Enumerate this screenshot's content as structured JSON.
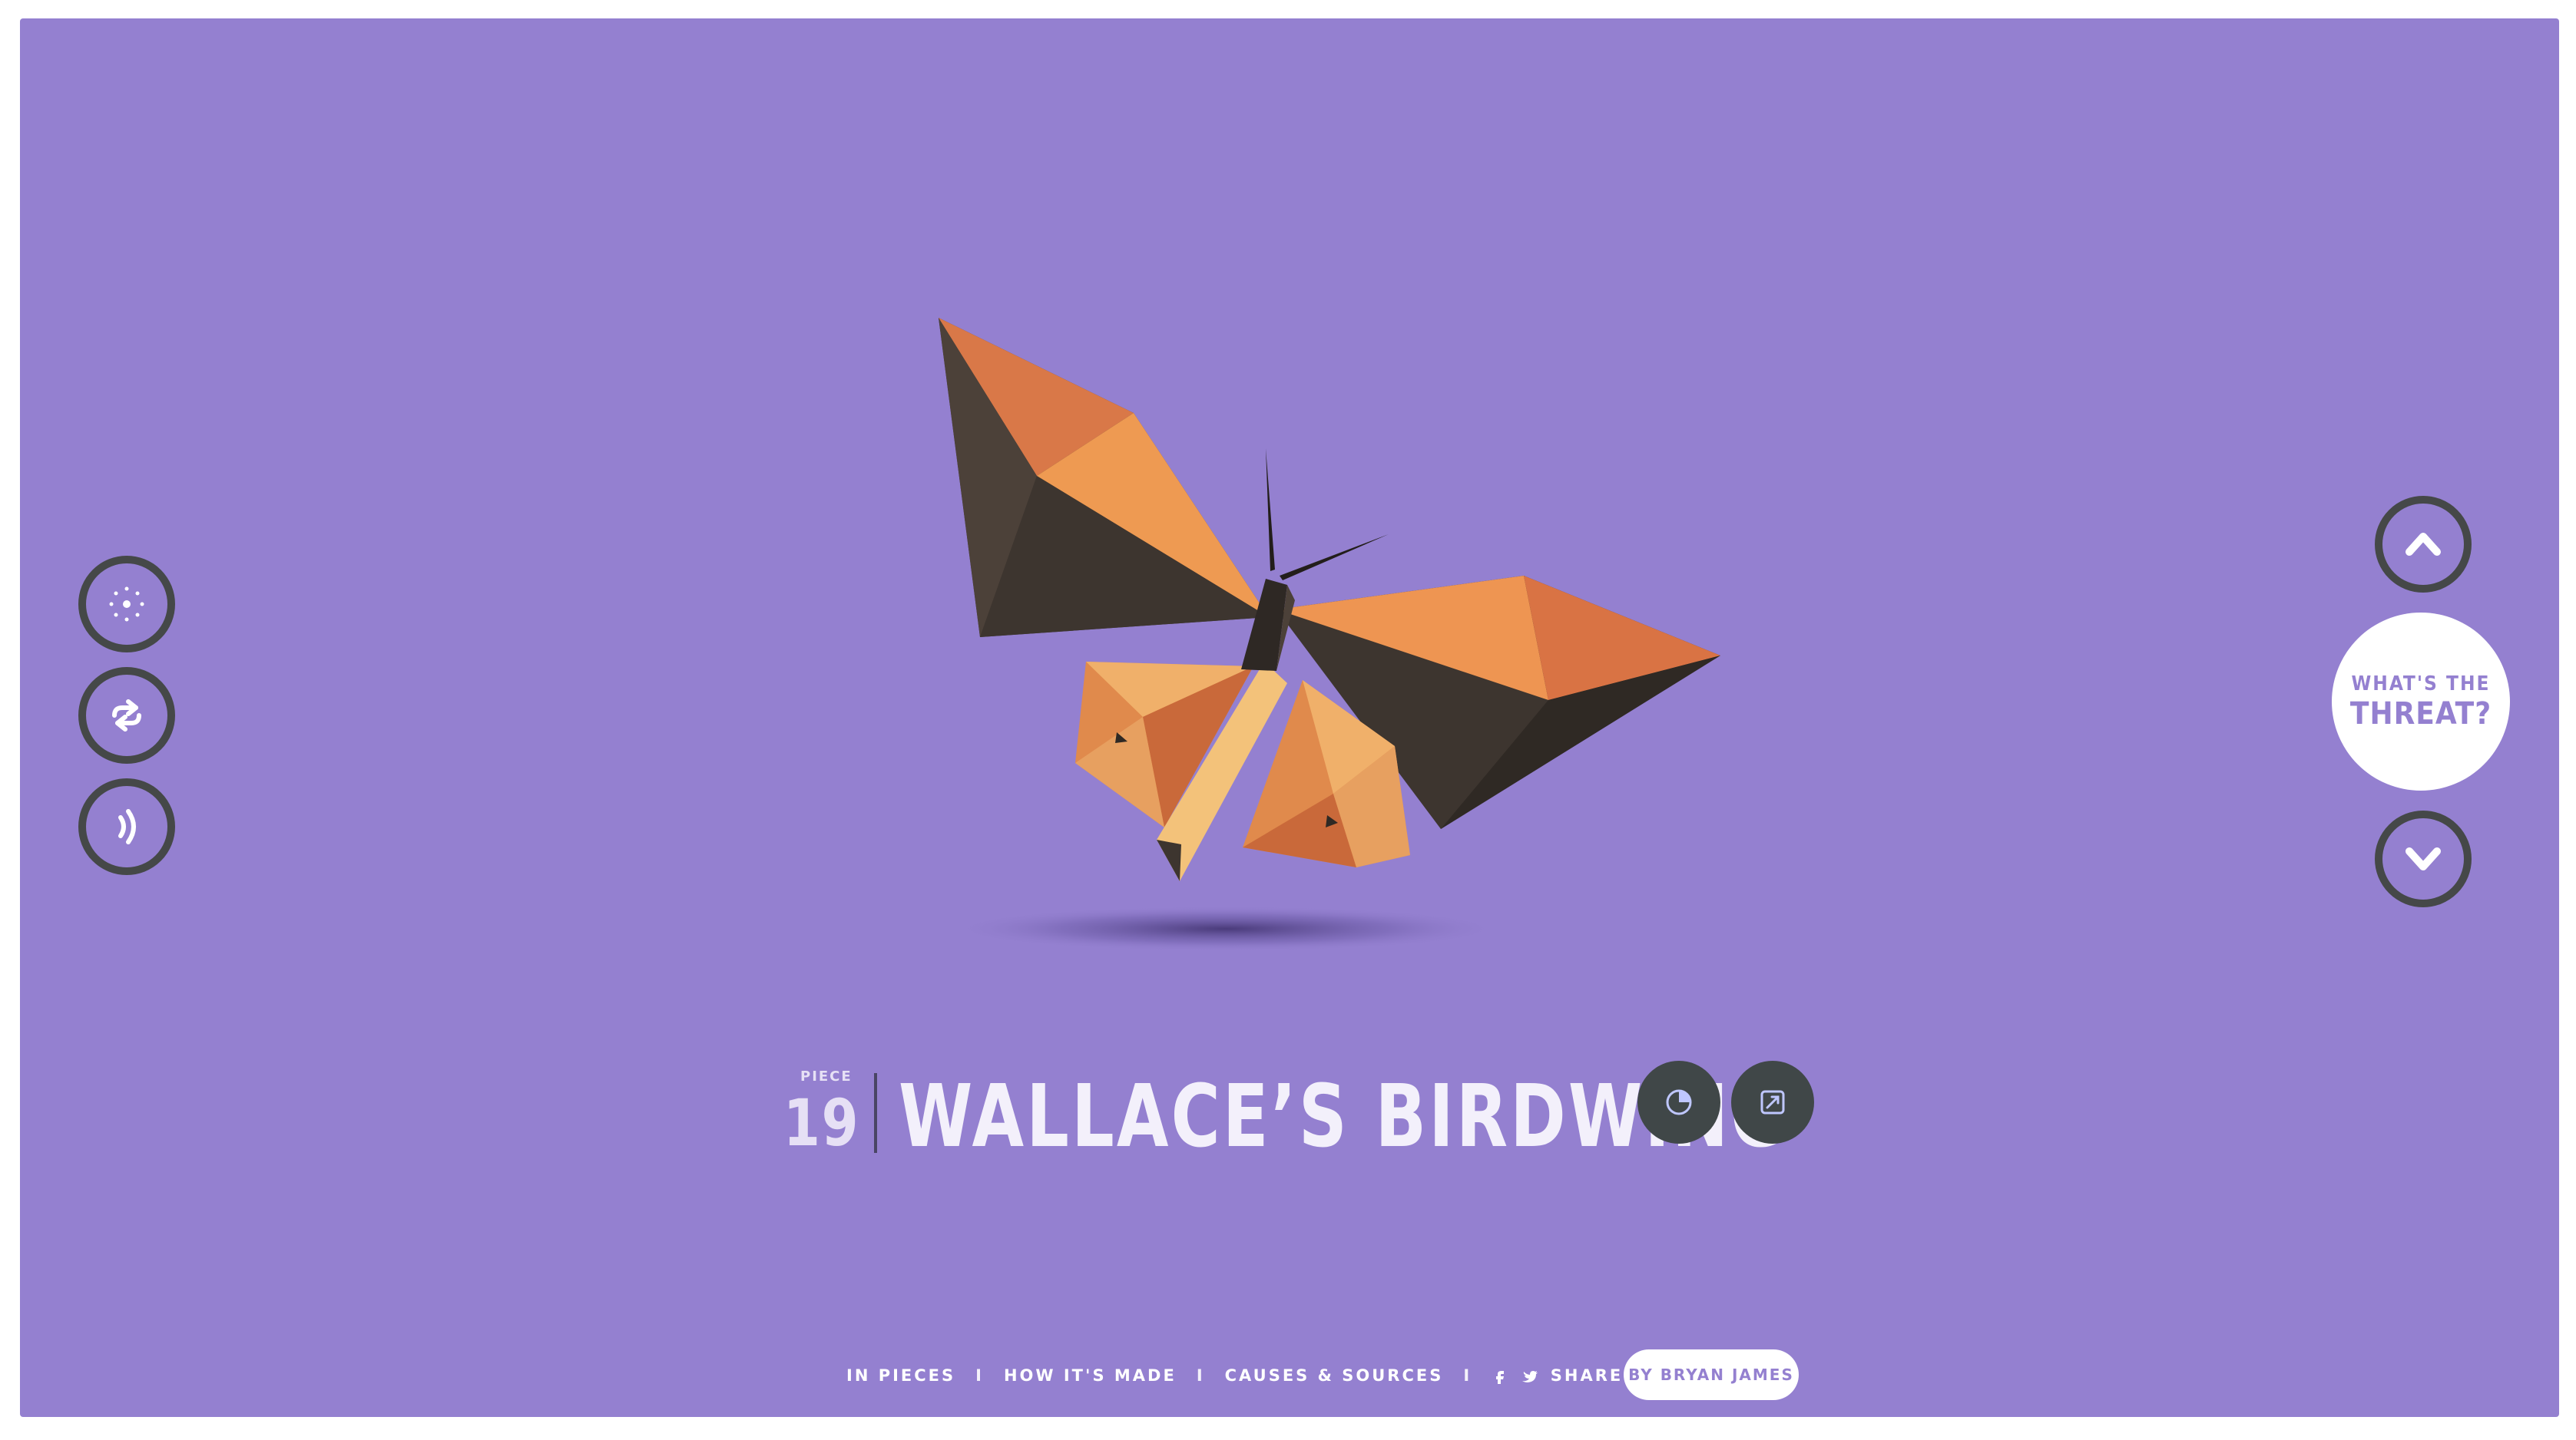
{
  "colors": {
    "background": "#9480d0",
    "ring": "#454848",
    "dark_button": "#404748",
    "title": "#f3f0fb",
    "wing_orange": "#e98a48",
    "wing_dark": "#433a33",
    "wing_light": "#f0b06a"
  },
  "left_controls": [
    {
      "icon": "dots-circle-icon"
    },
    {
      "icon": "shuffle-arrows-icon"
    },
    {
      "icon": "sound-waves-icon"
    }
  ],
  "right_controls": {
    "up_icon": "chevron-up-icon",
    "down_icon": "chevron-down-icon",
    "threat_line1": "WHAT'S THE",
    "threat_line2": "THREAT?"
  },
  "title": {
    "piece_label": "PIECE",
    "piece_number": "19",
    "species": "WALLACE’S BIRDWING",
    "stats_icon": "pie-chart-icon",
    "link_icon": "external-link-icon"
  },
  "footer": {
    "in_pieces": "IN PIECES",
    "separator": "I",
    "how_made": "HOW IT'S MADE",
    "causes": "CAUSES & SOURCES",
    "share": "SHARE & POSTER",
    "credit": "BY BRYAN JAMES"
  }
}
